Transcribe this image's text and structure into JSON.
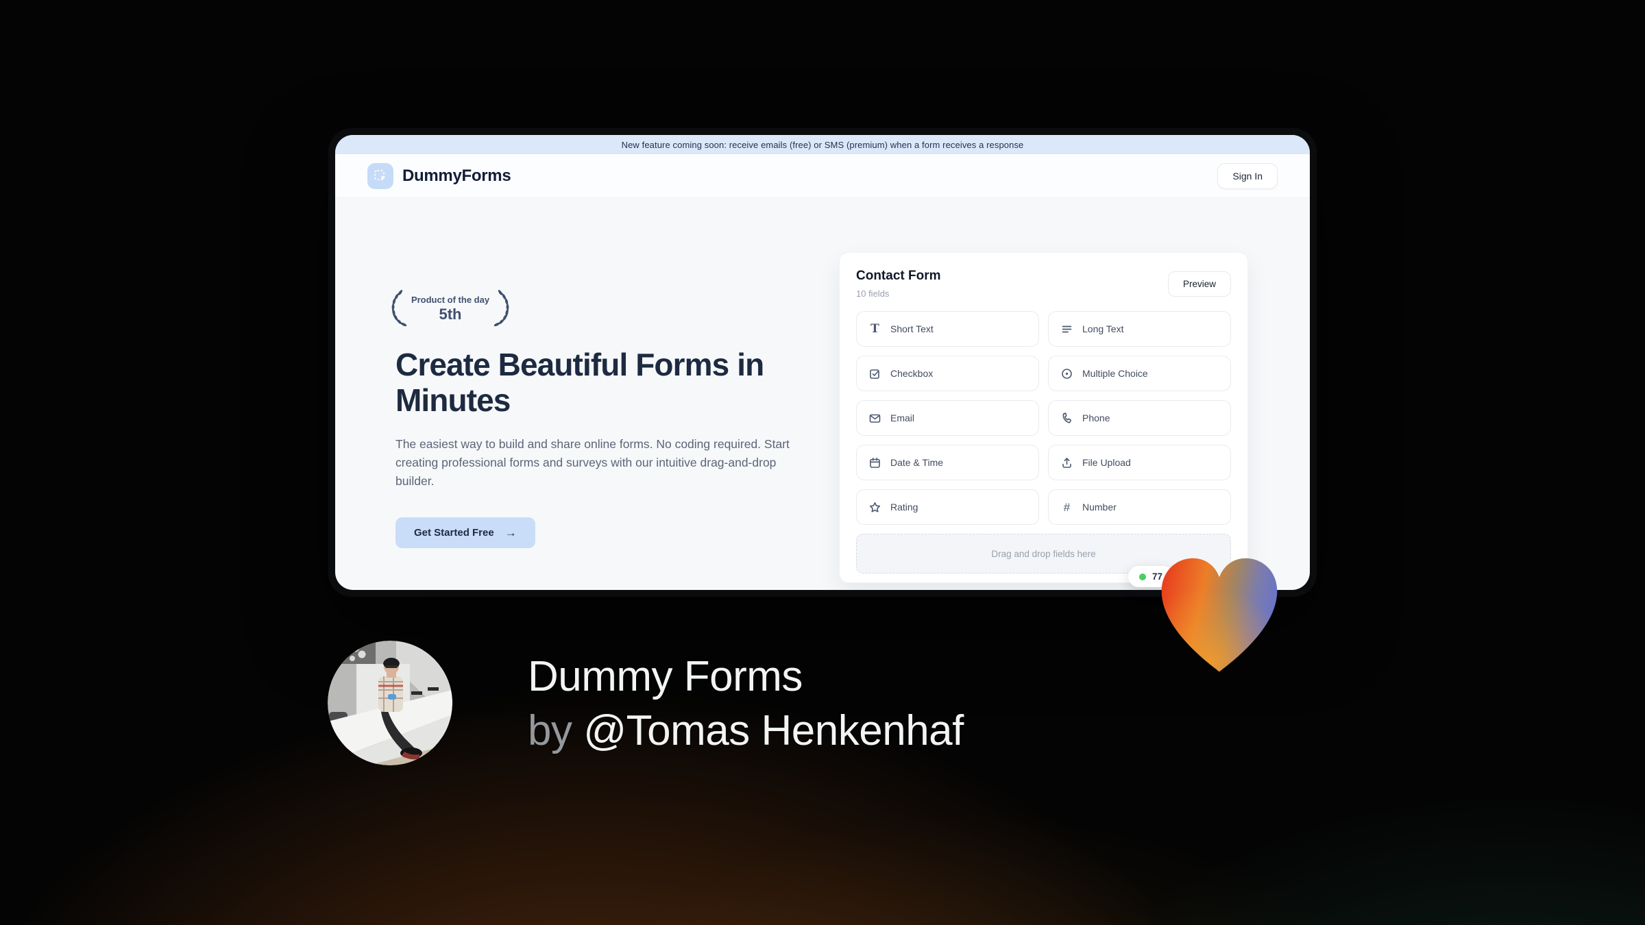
{
  "banner": {
    "text": "New feature coming soon: receive emails (free) or SMS (premium) when a form receives a response"
  },
  "header": {
    "brand": "DummyForms",
    "sign_in_label": "Sign In"
  },
  "hero": {
    "award": {
      "line1": "Product of the day",
      "line2": "5th"
    },
    "title": "Create Beautiful Forms in Minutes",
    "description": "The easiest way to build and share online forms. No coding required. Start creating professional forms and surveys with our intuitive drag-and-drop builder.",
    "cta_label": "Get Started Free",
    "cta_arrow": "→"
  },
  "form_builder": {
    "title": "Contact Form",
    "subtitle": "10 fields",
    "preview_label": "Preview",
    "fields": [
      {
        "label": "Short Text",
        "icon": "text-icon"
      },
      {
        "label": "Long Text",
        "icon": "lines-icon"
      },
      {
        "label": "Checkbox",
        "icon": "checkbox-icon"
      },
      {
        "label": "Multiple Choice",
        "icon": "radio-icon"
      },
      {
        "label": "Email",
        "icon": "envelope-icon"
      },
      {
        "label": "Phone",
        "icon": "phone-icon"
      },
      {
        "label": "Date & Time",
        "icon": "calendar-icon"
      },
      {
        "label": "File Upload",
        "icon": "upload-icon"
      },
      {
        "label": "Rating",
        "icon": "star-icon"
      },
      {
        "label": "Number",
        "icon": "hash-icon"
      }
    ],
    "field_glyphs": {
      "text": "T",
      "hash": "#"
    },
    "dropzone_text": "Drag and drop fields here",
    "live_badge_text": "77"
  },
  "footer": {
    "title": "Dummy Forms",
    "byline_prefix": "by ",
    "byline_handle": "@Tomas Henkenhaf"
  },
  "colors": {
    "banner_bg": "#dbe8fa",
    "accent_light_blue": "#c9ddf8",
    "navy": "#1d2a40",
    "green_dot": "#48cf63",
    "heart_gradient": [
      "#e8391d",
      "#ef8d2c",
      "#8b81a6",
      "#6b74c6"
    ]
  }
}
